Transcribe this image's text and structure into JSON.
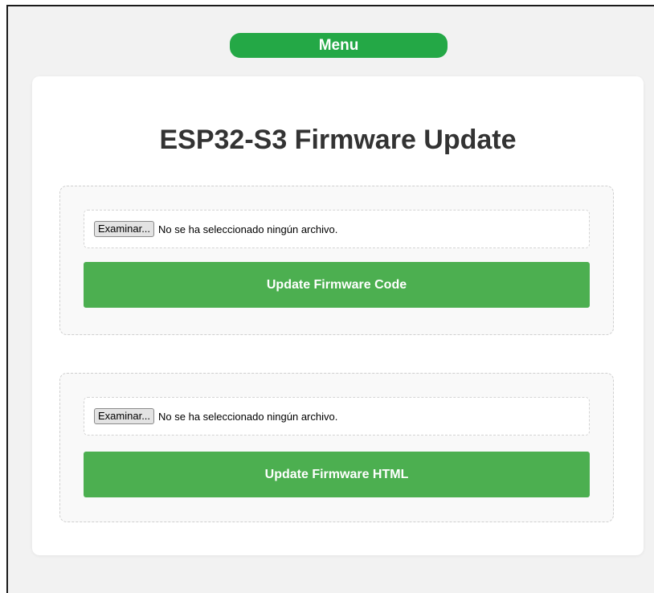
{
  "menu": {
    "label": "Menu"
  },
  "page": {
    "title": "ESP32-S3 Firmware Update"
  },
  "sections": [
    {
      "browse_label": "Examinar...",
      "file_status": "No se ha seleccionado ningún archivo.",
      "button_label": "Update Firmware Code"
    },
    {
      "browse_label": "Examinar...",
      "file_status": "No se ha seleccionado ningún archivo.",
      "button_label": "Update Firmware HTML"
    }
  ],
  "colors": {
    "menu_green": "#24a846",
    "button_green": "#4caf50",
    "title_text": "#333333",
    "page_background": "#f2f2f2"
  }
}
